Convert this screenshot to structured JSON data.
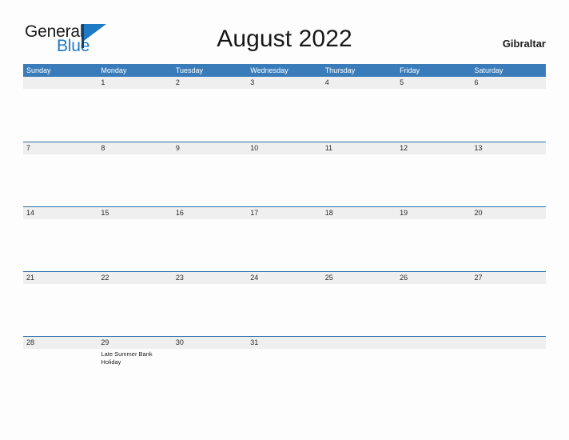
{
  "brand": {
    "name_part1": "General",
    "name_part2": "Blue",
    "primary_color": "#1f7ac4",
    "flag_icon": "triangle-flag-icon"
  },
  "header": {
    "title": "August 2022",
    "locale": "Gibraltar"
  },
  "calendar": {
    "month": "August",
    "year": "2022",
    "header_bg_color": "#3a7cba",
    "band_bg_color": "#efefef",
    "rule_color": "#2c6eab",
    "weekdays": [
      "Sunday",
      "Monday",
      "Tuesday",
      "Wednesday",
      "Thursday",
      "Friday",
      "Saturday"
    ],
    "weeks": [
      {
        "days": [
          {
            "number": "",
            "event": ""
          },
          {
            "number": "1",
            "event": ""
          },
          {
            "number": "2",
            "event": ""
          },
          {
            "number": "3",
            "event": ""
          },
          {
            "number": "4",
            "event": ""
          },
          {
            "number": "5",
            "event": ""
          },
          {
            "number": "6",
            "event": ""
          }
        ]
      },
      {
        "days": [
          {
            "number": "7",
            "event": ""
          },
          {
            "number": "8",
            "event": ""
          },
          {
            "number": "9",
            "event": ""
          },
          {
            "number": "10",
            "event": ""
          },
          {
            "number": "11",
            "event": ""
          },
          {
            "number": "12",
            "event": ""
          },
          {
            "number": "13",
            "event": ""
          }
        ]
      },
      {
        "days": [
          {
            "number": "14",
            "event": ""
          },
          {
            "number": "15",
            "event": ""
          },
          {
            "number": "16",
            "event": ""
          },
          {
            "number": "17",
            "event": ""
          },
          {
            "number": "18",
            "event": ""
          },
          {
            "number": "19",
            "event": ""
          },
          {
            "number": "20",
            "event": ""
          }
        ]
      },
      {
        "days": [
          {
            "number": "21",
            "event": ""
          },
          {
            "number": "22",
            "event": ""
          },
          {
            "number": "23",
            "event": ""
          },
          {
            "number": "24",
            "event": ""
          },
          {
            "number": "25",
            "event": ""
          },
          {
            "number": "26",
            "event": ""
          },
          {
            "number": "27",
            "event": ""
          }
        ]
      },
      {
        "days": [
          {
            "number": "28",
            "event": ""
          },
          {
            "number": "29",
            "event": "Late Summer Bank Holiday"
          },
          {
            "number": "30",
            "event": ""
          },
          {
            "number": "31",
            "event": ""
          },
          {
            "number": "",
            "event": ""
          },
          {
            "number": "",
            "event": ""
          },
          {
            "number": "",
            "event": ""
          }
        ]
      }
    ]
  }
}
